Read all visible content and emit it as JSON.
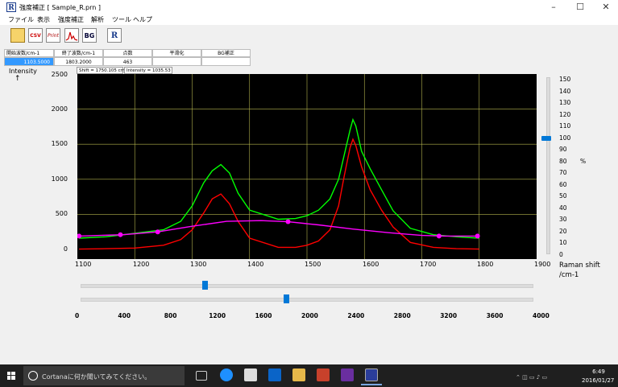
{
  "window": {
    "title": "強度補正 [ Sample_R.prn ]",
    "app_icon": "R",
    "minimize": "–",
    "maximize": "☐",
    "close": "✕"
  },
  "menu": [
    "ファイル",
    "表示",
    "強度補正",
    "解析",
    "ツール",
    "ヘルプ"
  ],
  "toolbar": {
    "buttons": [
      {
        "icon": "folder-open-icon",
        "label": ""
      },
      {
        "icon": "csv-icon",
        "label": "CSV"
      },
      {
        "icon": "print-icon",
        "label": "Print"
      },
      {
        "icon": "spectrum-icon",
        "label": ""
      },
      {
        "icon": "bg-icon",
        "label": "BG"
      },
      {
        "icon": "r-logo-icon",
        "label": "R"
      }
    ]
  },
  "params": {
    "headers": [
      "開始波数/cm-1",
      "終了波数/cm-1",
      "点数",
      "平滑化",
      "BG補正"
    ],
    "values": [
      "1103.5000",
      "1803.2000",
      "463",
      "",
      ""
    ]
  },
  "cursor": {
    "shift": "Shift = 1750.105 cm-1",
    "intensity": "Intensity = 1035.53"
  },
  "plot": {
    "y_title": "Intensity",
    "y_arrow": "↑",
    "y_ticks": [
      "2500",
      "2000",
      "1500",
      "1000",
      "500",
      "0"
    ],
    "x_ticks": [
      "1100",
      "1200",
      "1300",
      "1400",
      "1500",
      "1600",
      "1700",
      "1800",
      "1900"
    ],
    "x_title_1": "Raman shift",
    "x_title_2": "/cm-1",
    "pct_ticks": [
      "150",
      "140",
      "130",
      "120",
      "110",
      "100",
      "90",
      "80",
      "70",
      "60",
      "50",
      "40",
      "30",
      "20",
      "10",
      "0"
    ],
    "pct_unit": "%",
    "pct_value": 100,
    "colors": {
      "background": "#000000",
      "grid": "#b3b34d",
      "raw": "#00ff00",
      "corrected": "#ff0000",
      "baseline": "#ff00ff"
    }
  },
  "sliders": {
    "scale_ticks": [
      "0",
      "400",
      "800",
      "1200",
      "1600",
      "2000",
      "2400",
      "2800",
      "3200",
      "3600",
      "4000"
    ],
    "slider1_value": 1103.5,
    "slider2_value": 1803.2
  },
  "taskbar": {
    "search_text": "Cortanaに何か聞いてみてください。",
    "time": "6:49",
    "date": "2016/01/27"
  },
  "chart_data": {
    "type": "line",
    "xlabel": "Raman shift /cm-1",
    "ylabel": "Intensity",
    "xlim": [
      1100,
      1900
    ],
    "ylim": [
      0,
      2500
    ],
    "grid": true,
    "series": [
      {
        "color": "#00ff00",
        "x": [
          1103,
          1150,
          1200,
          1250,
          1280,
          1300,
          1320,
          1335,
          1350,
          1365,
          1380,
          1400,
          1450,
          1480,
          1500,
          1520,
          1540,
          1555,
          1565,
          1575,
          1580,
          1585,
          1595,
          1610,
          1630,
          1650,
          1680,
          1720,
          1760,
          1800
        ],
        "y": [
          160,
          180,
          230,
          280,
          400,
          620,
          950,
          1120,
          1210,
          1090,
          800,
          560,
          430,
          440,
          480,
          560,
          720,
          1000,
          1350,
          1700,
          1850,
          1760,
          1400,
          1150,
          850,
          550,
          300,
          210,
          180,
          160
        ]
      },
      {
        "color": "#ff0000",
        "x": [
          1103,
          1150,
          1200,
          1250,
          1280,
          1300,
          1320,
          1335,
          1350,
          1365,
          1380,
          1400,
          1450,
          1480,
          1500,
          1520,
          1540,
          1555,
          1565,
          1575,
          1580,
          1585,
          1595,
          1610,
          1630,
          1650,
          1680,
          1720,
          1760,
          1800
        ],
        "y": [
          5,
          10,
          20,
          60,
          140,
          280,
          520,
          720,
          790,
          650,
          400,
          160,
          30,
          30,
          60,
          120,
          280,
          620,
          1050,
          1450,
          1570,
          1480,
          1180,
          850,
          560,
          320,
          100,
          30,
          10,
          5
        ]
      },
      {
        "color": "#ff00ff",
        "x": [
          1103,
          1180,
          1240,
          1300,
          1360,
          1420,
          1467,
          1520,
          1580,
          1640,
          1700,
          1740,
          1800
        ],
        "y": [
          190,
          210,
          250,
          330,
          400,
          410,
          395,
          350,
          290,
          240,
          200,
          190,
          190
        ]
      }
    ],
    "markers": [
      {
        "x": 1103,
        "y": 190
      },
      {
        "x": 1175,
        "y": 210
      },
      {
        "x": 1240,
        "y": 250
      },
      {
        "x": 1467,
        "y": 395
      },
      {
        "x": 1730,
        "y": 190
      },
      {
        "x": 1797,
        "y": 190
      }
    ]
  }
}
